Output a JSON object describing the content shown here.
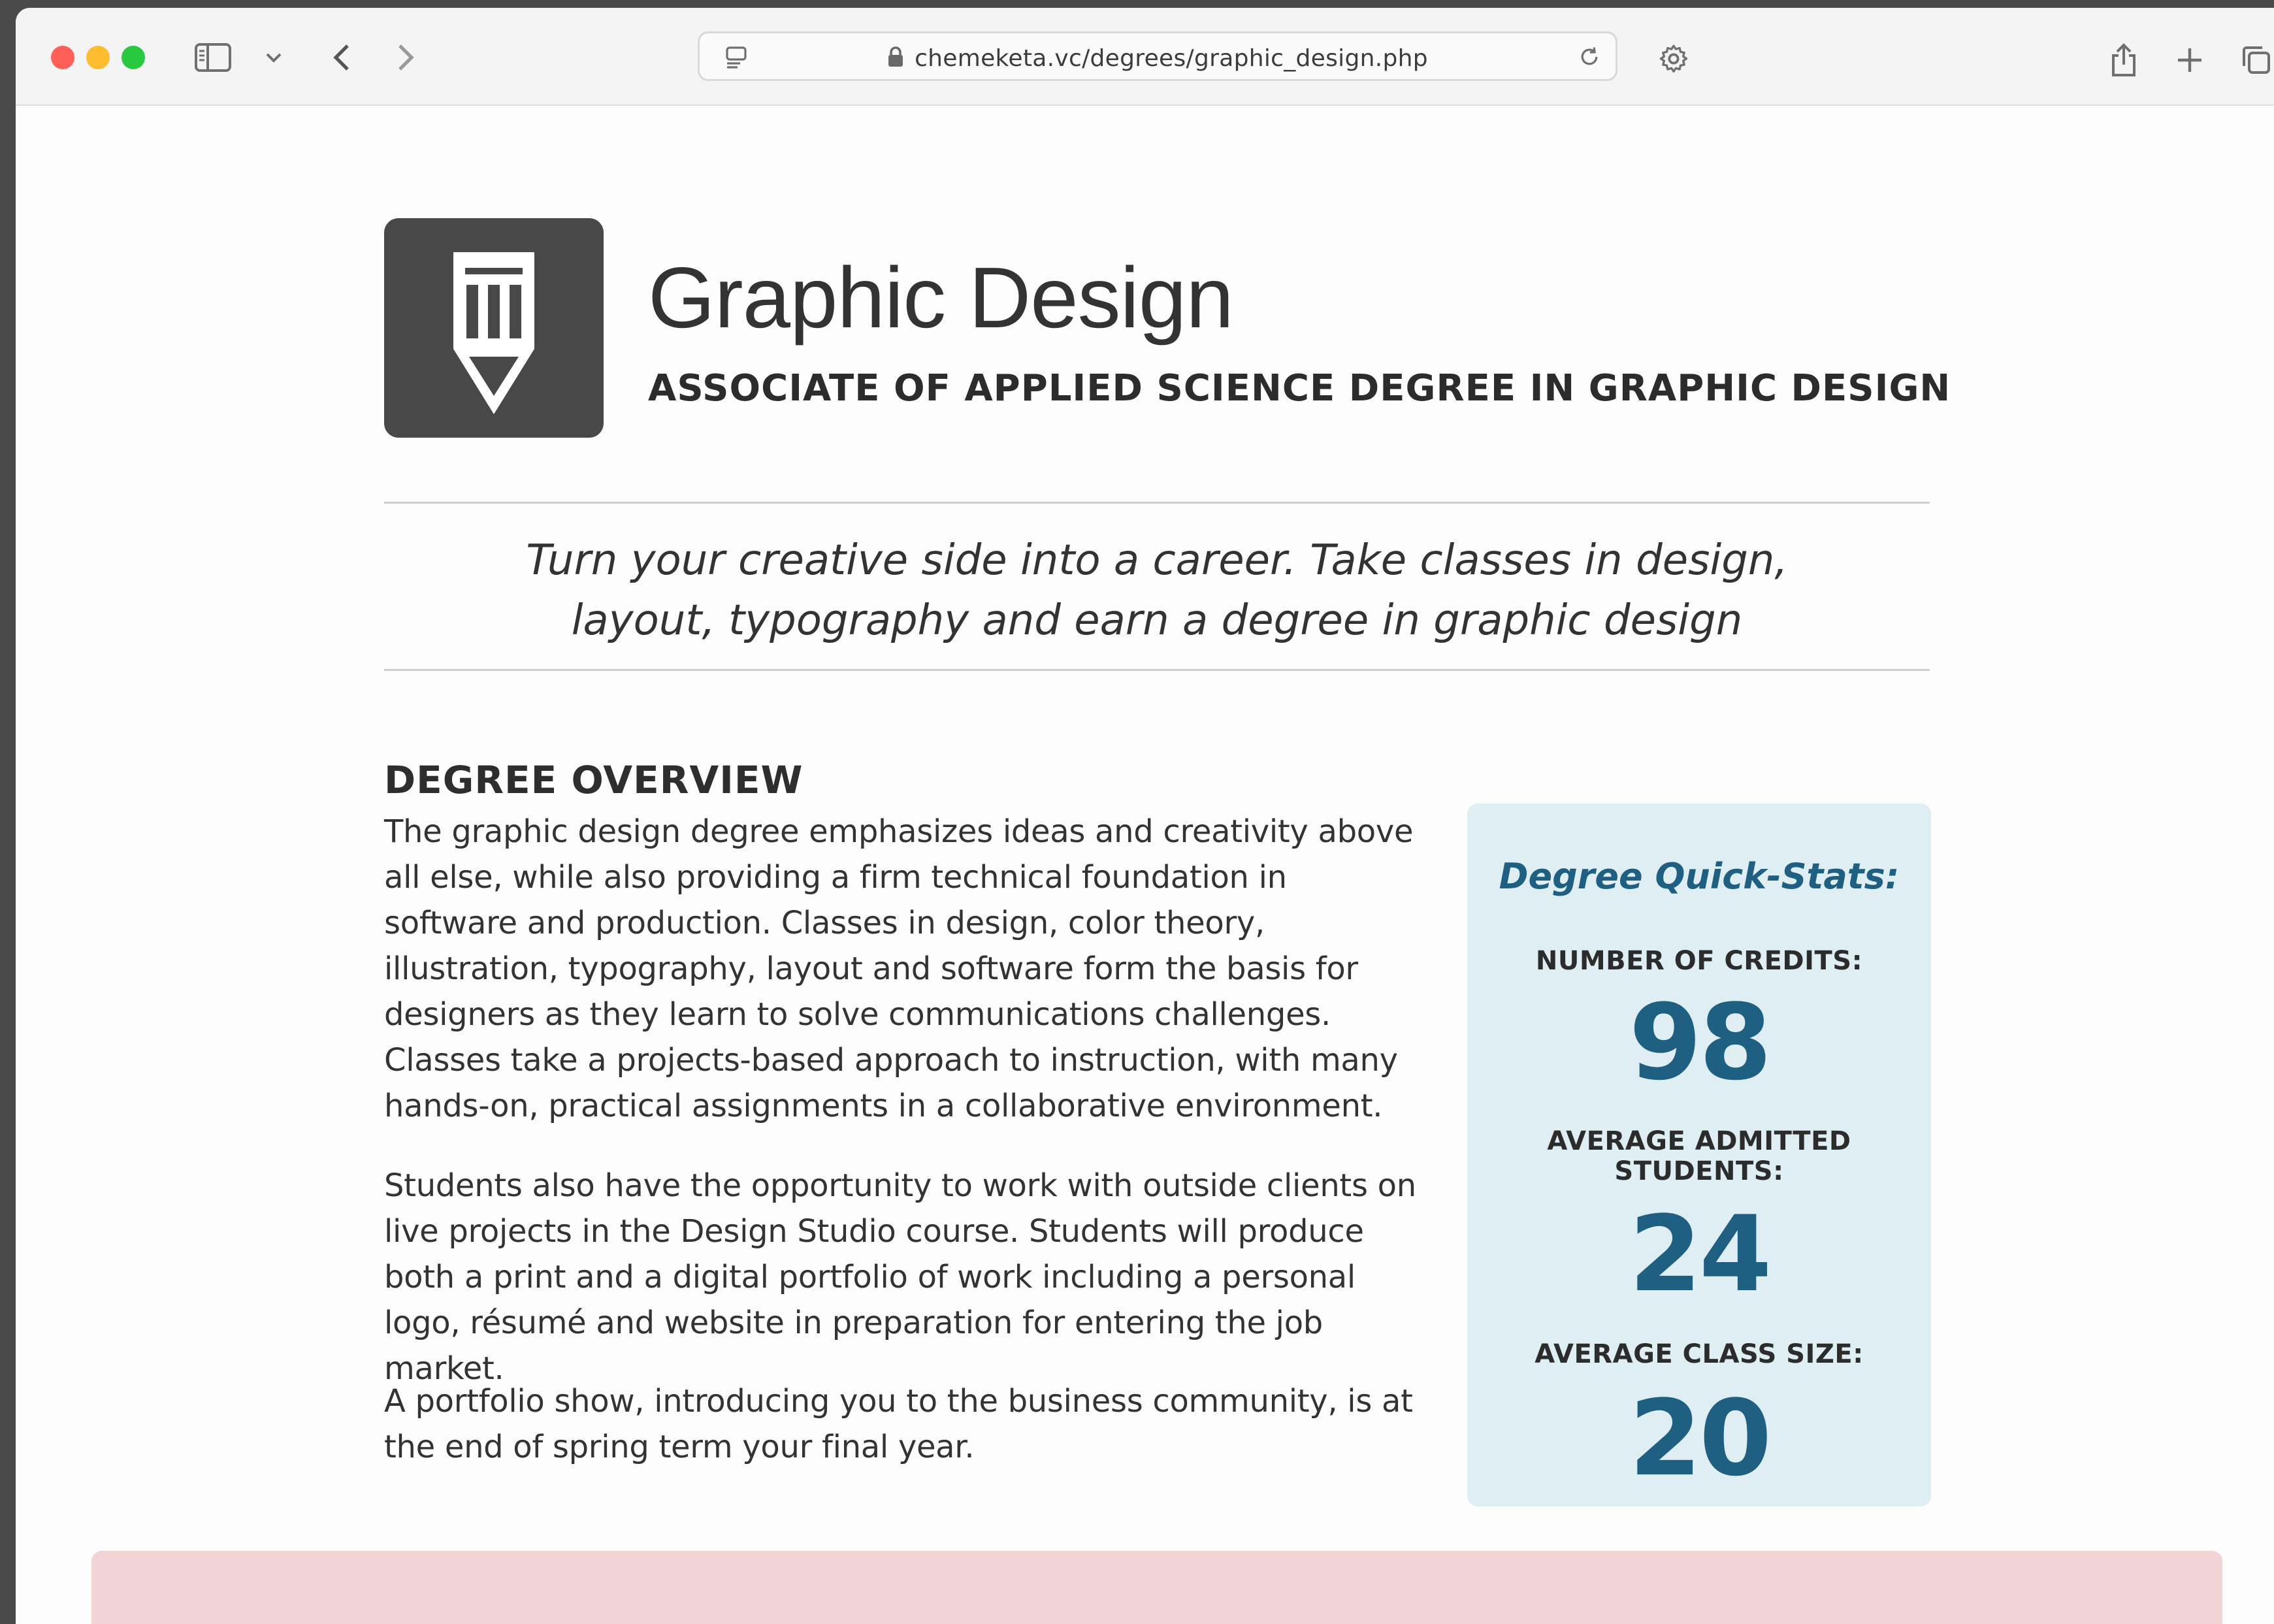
{
  "browser": {
    "url": "chemeketa.vc/degrees/graphic_design.php"
  },
  "header": {
    "icon": "pencil-icon",
    "title": "Graphic Design",
    "subtitle": "ASSOCIATE OF APPLIED SCIENCE DEGREE IN GRAPHIC DESIGN"
  },
  "tagline": {
    "line1": "Turn your creative side into a career. Take classes in design,",
    "line2": "layout, typography and earn a degree in graphic design"
  },
  "overview": {
    "title": "DEGREE OVERVIEW",
    "paragraphs": [
      "The graphic design degree emphasizes ideas and creativity above all else, while also providing a firm technical foundation in software and production. Classes in design, color theory, illustration, typography, layout and software form the basis for designers as they learn to solve communications challenges. Classes take a projects-based approach to instruction, with many hands-on, practical assignments in a collaborative environment.",
      "Students also have the opportunity to work with outside clients on live projects in the Design Studio course. Students will produce both a print and a digital portfolio of work including a personal logo, résumé and website in preparation for entering the job market.",
      "A portfolio show, introducing you to the business community, is at the end of spring term your final year."
    ]
  },
  "quick_stats": {
    "title": "Degree Quick-Stats:",
    "items": [
      {
        "label": "NUMBER OF CREDITS:",
        "value": "98"
      },
      {
        "label": "AVERAGE ADMITTED STUDENTS:",
        "value": "24"
      },
      {
        "label": "AVERAGE CLASS SIZE:",
        "value": "20"
      }
    ]
  },
  "colors": {
    "accent": "#1e5f82",
    "stats_bg": "#deeef3",
    "icon_bg": "#484848",
    "band": "#f2d3d6"
  }
}
